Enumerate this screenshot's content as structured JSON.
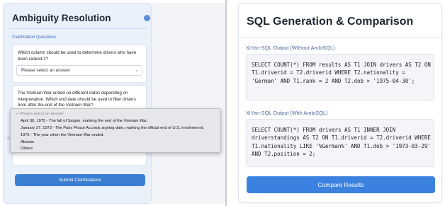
{
  "left": {
    "title": "Ambiguity Resolution",
    "section_label": "Clarification Questions",
    "q1": {
      "text": "Which column should be used to determine drivers who have been ranked 2?",
      "select": "Please select an answer"
    },
    "q2": {
      "text": "The Vietnam War ended on different dates depending on interpretation. Which end date should be used to filter drivers born after the end of the Vietnam War?"
    },
    "partial_letter": "A",
    "submit_label": "Submit Clarifications"
  },
  "dropdown": {
    "placeholder": "✓ Please select an answer",
    "options": [
      "April 30, 1975 - The fall of Saigon, marking the end of the Vietnam War.",
      "January 27, 1973 - The Paris Peace Accords signing date, marking the official end of U.S. involvement.",
      "1975 - The year when the Vietnam War ended.",
      "Abstain",
      "Others"
    ]
  },
  "right": {
    "title": "SQL Generation & Comparison",
    "label_without": "XiYan-SQL Output (Without AmbiSQL)",
    "sql_without": "SELECT COUNT(*) FROM results AS T1 JOIN drivers AS T2 ON T1.driverid = T2.driverid WHERE T2.nationality = 'German' AND T1.rank = 2 AND T2.dob > '1975-04-30';",
    "label_with": "XiYan-SQL Output (With AmbiSQL)",
    "sql_with": "SELECT COUNT(*) FROM drivers AS T1 INNER JOIN driverstandings AS T2 ON T1.driverid = T2.driverid WHERE T1.nationality LIKE '%German%' AND T1.dob > '1973-03-29' AND T2.position = 2;",
    "compare_label": "Compare Results"
  },
  "colors": {
    "accent": "#3b82e0",
    "panel_bg": "#eaf1fb",
    "label_blue": "#3a6bc0"
  }
}
